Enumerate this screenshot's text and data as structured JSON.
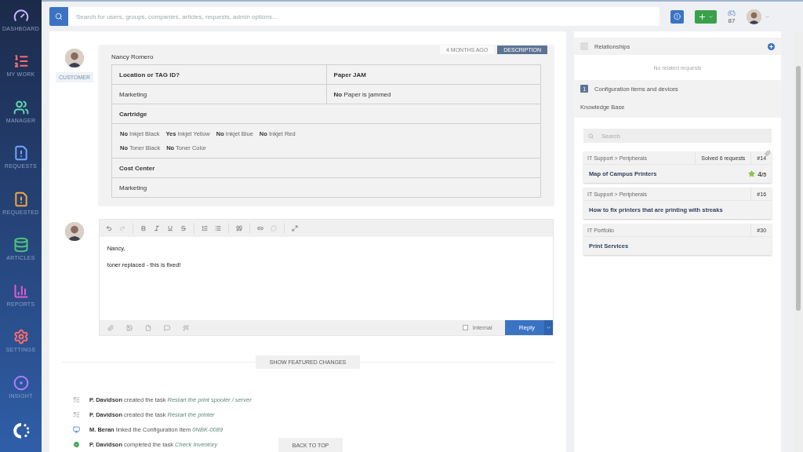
{
  "sidebar": {
    "items": [
      {
        "label": "DASHBOARD"
      },
      {
        "label": "MY WORK"
      },
      {
        "label": "MANAGER"
      },
      {
        "label": "REQUESTS"
      },
      {
        "label": "REQUESTED"
      },
      {
        "label": "ARTICLES"
      },
      {
        "label": "REPORTS"
      },
      {
        "label": "SETTINGS"
      },
      {
        "label": "INSIGHT"
      }
    ]
  },
  "topbar": {
    "search": {
      "placeholder": "Search for users, groups, companies, articles, requests, admin options..."
    },
    "notification_count": "87"
  },
  "description": {
    "author": "Nancy Romero",
    "role": "CUSTOMER",
    "time": "4 MONTHS AGO",
    "tab": "DESCRIPTION",
    "rows": [
      {
        "kind": "label",
        "cells": [
          "Location or TAG ID?",
          "Paper JAM"
        ]
      },
      {
        "kind": "value",
        "cells": [
          "Marketing",
          "**No** Paper is jammed"
        ]
      },
      {
        "kind": "label",
        "cells": [
          "Cartridge"
        ]
      },
      {
        "kind": "options",
        "options": [
          [
            "**No** Inkjet Black",
            "**Yes** Inkjet Yellow",
            "**No** Inkjet Blue",
            "**No** Inkjet Red"
          ],
          [
            "**No** Toner Black",
            "**No** Toner Color"
          ]
        ]
      },
      {
        "kind": "label",
        "cells": [
          "Cost Center"
        ]
      },
      {
        "kind": "value",
        "cells": [
          "Marketing"
        ]
      }
    ]
  },
  "editor": {
    "lines": [
      "Nancy,",
      "toner replaced - this is fixed!"
    ],
    "internal": {
      "label": "Internal",
      "checked": false
    },
    "reply_button": "Reply"
  },
  "featured_changes_button": "SHOW FEATURED CHANGES",
  "activity": [
    {
      "kind": "task",
      "actor": "P. Davidson",
      "action": "created the task",
      "target": "Restart the print spooler / server"
    },
    {
      "kind": "task",
      "actor": "P. Davidson",
      "action": "created the task",
      "target": "Restart the printer"
    },
    {
      "kind": "device",
      "actor": "M. Beran",
      "action": "linked the Configuration Item",
      "target": "0NBK-0089"
    },
    {
      "kind": "done",
      "actor": "P. Davidson",
      "action": "completed the task",
      "target": "Check Inventory"
    }
  ],
  "back_to_top": "BACK TO TOP",
  "right_panel": {
    "relationships": {
      "title": "Relationships",
      "empty": "No related requests"
    },
    "configuration": {
      "count": "1",
      "title": "Configuration items and devices"
    },
    "knowledge_base": {
      "title": "Knowledge Base",
      "search_placeholder": "Search",
      "articles": [
        {
          "category": "IT Support > Peripherals",
          "solved": "Solved 6 requests",
          "number": "#14",
          "title": "Map of Campus Printers",
          "rating": "4",
          "rating_max": "/5",
          "attachment": true
        },
        {
          "category": "IT Support > Peripherals",
          "number": "#16",
          "title": "How to fix printers that are printing with streaks",
          "attachment": false
        },
        {
          "category": "IT Portfolio",
          "number": "#30",
          "title": "Print Services",
          "attachment": false
        }
      ]
    }
  }
}
